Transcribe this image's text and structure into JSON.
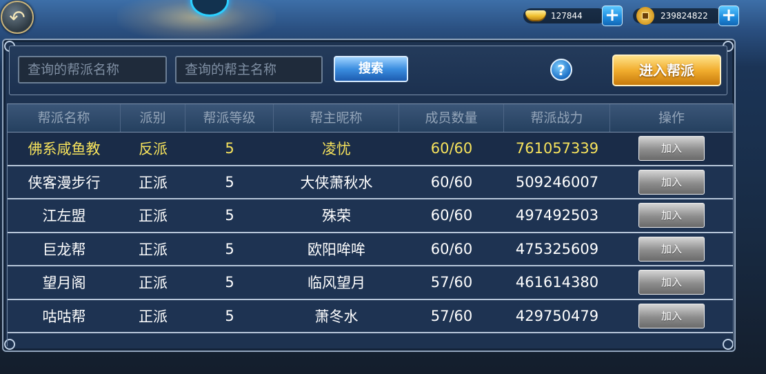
{
  "resources": {
    "gold_ingot": "127844",
    "copper_coin": "239824822",
    "add_symbol": "+"
  },
  "nav": {
    "back_symbol": "↶"
  },
  "search": {
    "guild_name_placeholder": "查询的帮派名称",
    "leader_name_placeholder": "查询的帮主名称",
    "search_label": "搜索",
    "help_label": "?",
    "enter_guild_label": "进入帮派"
  },
  "table": {
    "headers": [
      "帮派名称",
      "派别",
      "帮派等级",
      "帮主昵称",
      "成员数量",
      "帮派战力",
      "操作"
    ],
    "rows": [
      {
        "name": "佛系咸鱼教",
        "faction": "反派",
        "level": "5",
        "leader": "凌忧",
        "members": "60/60",
        "power": "761057339",
        "action": "加入"
      },
      {
        "name": "侠客漫步行",
        "faction": "正派",
        "level": "5",
        "leader": "大侠萧秋水",
        "members": "60/60",
        "power": "509246007",
        "action": "加入"
      },
      {
        "name": "江左盟",
        "faction": "正派",
        "level": "5",
        "leader": "殊荣",
        "members": "60/60",
        "power": "497492503",
        "action": "加入"
      },
      {
        "name": "巨龙帮",
        "faction": "正派",
        "level": "5",
        "leader": "欧阳哞哞",
        "members": "60/60",
        "power": "475325609",
        "action": "加入"
      },
      {
        "name": "望月阁",
        "faction": "正派",
        "level": "5",
        "leader": "临风望月",
        "members": "57/60",
        "power": "461614380",
        "action": "加入"
      },
      {
        "name": "咕咕帮",
        "faction": "正派",
        "level": "5",
        "leader": "萧冬水",
        "members": "57/60",
        "power": "429750479",
        "action": "加入"
      }
    ]
  },
  "colors": {
    "highlight_text": "#f7e35c",
    "normal_text": "#ffffff",
    "header_text": "#93a4b8"
  }
}
